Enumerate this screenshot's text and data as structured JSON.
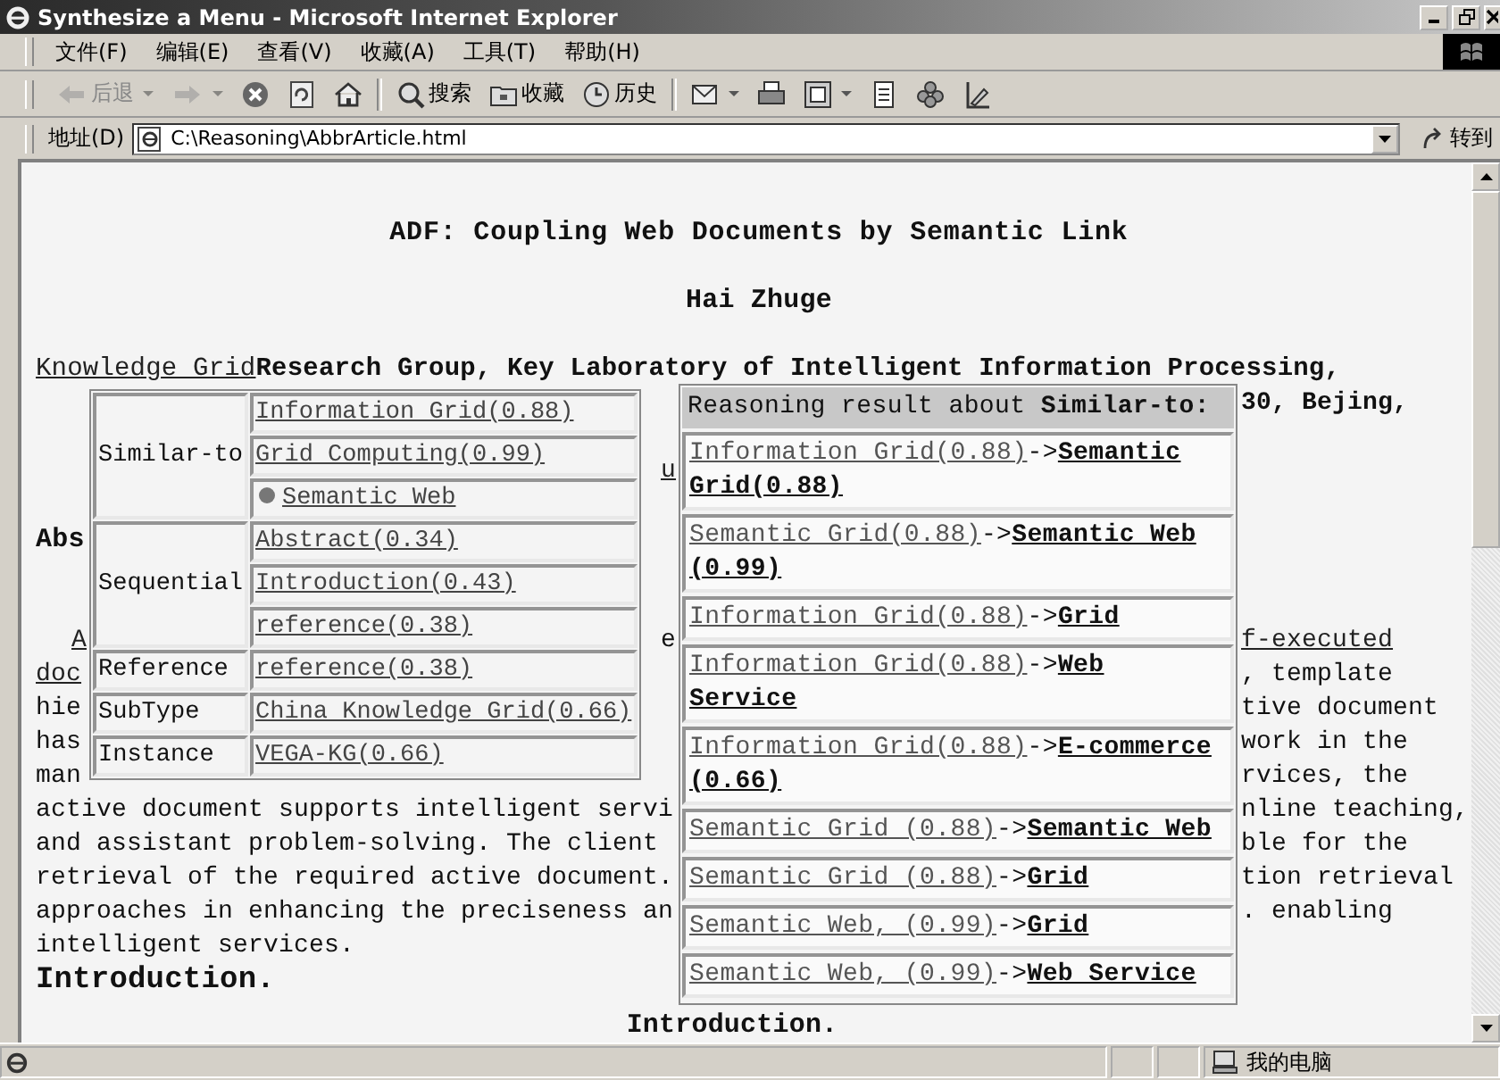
{
  "window": {
    "title": "Synthesize a Menu - Microsoft Internet Explorer"
  },
  "menu": [
    "文件(F)",
    "编辑(E)",
    "查看(V)",
    "收藏(A)",
    "工具(T)",
    "帮助(H)"
  ],
  "toolbar": [
    {
      "kind": "back",
      "label": "后退",
      "disabled": true,
      "dropdown": true
    },
    {
      "kind": "forward",
      "disabled": true,
      "dropdown": true
    },
    {
      "kind": "stop",
      "disabled": false,
      "dropdown": false
    },
    {
      "kind": "refresh",
      "disabled": false,
      "dropdown": false
    },
    {
      "kind": "home",
      "disabled": false,
      "dropdown": false
    },
    {
      "kind": "search",
      "label": "搜索",
      "disabled": false,
      "dropdown": false
    },
    {
      "kind": "favorites",
      "label": "收藏",
      "disabled": false,
      "dropdown": false
    },
    {
      "kind": "history",
      "label": "历史",
      "disabled": false,
      "dropdown": false
    },
    {
      "kind": "mail",
      "disabled": false,
      "dropdown": true
    },
    {
      "kind": "print",
      "disabled": false,
      "dropdown": false
    },
    {
      "kind": "edit",
      "disabled": false,
      "dropdown": true
    },
    {
      "kind": "discuss",
      "disabled": false,
      "dropdown": false
    },
    {
      "kind": "messenger",
      "disabled": false,
      "dropdown": false
    },
    {
      "kind": "research",
      "disabled": false,
      "dropdown": false
    }
  ],
  "address": {
    "label": "地址(D)",
    "value": "C:\\Reasoning\\AbbrArticle.html",
    "go": "转到"
  },
  "article": {
    "title": "ADF: Coupling Web Documents by Semantic Link",
    "author": "Hai Zhuge",
    "affiliation_link": "Knowledge Grid",
    "affiliation": "Research Group, Key Laboratory of Intelligent Information Processing,",
    "rows": [
      {
        "right": {
          "text": "30, Bejing,",
          "kind": "bold"
        }
      },
      {
        "mid": {
          "text": "u",
          "kind": "link"
        }
      },
      {
        "left": {
          "text": "Abs",
          "kind": "heading"
        }
      },
      {
        "left": {
          "text": "A",
          "kind": "indented-link"
        },
        "mid": {
          "text": "e",
          "kind": "plain"
        },
        "right": {
          "text": "f-executed",
          "kind": "link"
        }
      },
      {
        "left": {
          "text": "doc",
          "kind": "link"
        },
        "right": {
          "text": ", template",
          "kind": "plain"
        }
      },
      {
        "left": {
          "text": "hie",
          "kind": "plain"
        },
        "right": {
          "text": "tive document",
          "kind": "plain"
        }
      },
      {
        "left": {
          "text": "has",
          "kind": "plain"
        },
        "right": {
          "text": "work in the",
          "kind": "plain"
        }
      },
      {
        "left": {
          "text": "man",
          "kind": "plain"
        },
        "right": {
          "text": "rvices, the",
          "kind": "plain"
        }
      },
      {
        "left": {
          "text": "active document supports intelligent servi",
          "kind": "plain"
        },
        "right": {
          "text": "nline teaching,",
          "kind": "plain"
        }
      },
      {
        "left": {
          "text": "and assistant problem-solving. The client",
          "kind": "plain"
        },
        "right": {
          "text": "ble for the",
          "kind": "plain"
        }
      },
      {
        "left": {
          "text": "retrieval of the required active document.",
          "kind": "plain"
        },
        "right": {
          "text": "tion retrieval",
          "kind": "plain"
        }
      },
      {
        "left": {
          "text": "approaches in enhancing the preciseness an",
          "kind": "plain"
        },
        "right": {
          "text": ". enabling",
          "kind": "plain"
        }
      },
      {
        "left": {
          "text": "intelligent services.",
          "kind": "plain"
        }
      },
      {
        "left": {
          "text": "Introduction.",
          "kind": "section"
        }
      }
    ],
    "footer_heading": "Introduction."
  },
  "relations_popup": {
    "groups": [
      {
        "relation": "Similar-to",
        "targets": [
          {
            "text": "Information Grid(0.88)",
            "bullet": false
          },
          {
            "text": "Grid Computing(0.99)",
            "bullet": false
          },
          {
            "text": "Semantic Web",
            "bullet": true
          }
        ]
      },
      {
        "relation": "Sequential",
        "targets": [
          {
            "text": "Abstract(0.34)",
            "bullet": false
          },
          {
            "text": "Introduction(0.43)",
            "bullet": false
          },
          {
            "text": "reference(0.38)",
            "bullet": false
          }
        ]
      },
      {
        "relation": "Reference",
        "targets": [
          {
            "text": "reference(0.38)",
            "bullet": false
          }
        ]
      },
      {
        "relation": "SubType",
        "targets": [
          {
            "text": "China Knowledge Grid(0.66)",
            "bullet": false
          }
        ]
      },
      {
        "relation": "Instance",
        "targets": [
          {
            "text": "VEGA-KG(0.66)",
            "bullet": false
          }
        ]
      }
    ]
  },
  "reasoning_popup": {
    "heading": "Reasoning result about ",
    "heading_relation": "Similar-to:",
    "results": [
      {
        "from": "Information Grid(0.88)",
        "arrow": "->",
        "to": "Semantic Grid(0.88)"
      },
      {
        "from": "Semantic Grid(0.88)",
        "arrow": "->",
        "to": "Semantic Web (0.99)"
      },
      {
        "from": "Information Grid(0.88)",
        "arrow": "->",
        "to": "Grid"
      },
      {
        "from": "Information Grid(0.88)",
        "arrow": "->",
        "to": "Web Service"
      },
      {
        "from": "Information Grid(0.88)",
        "arrow": "->",
        "to": "E-commerce (0.66)"
      },
      {
        "from": "Semantic Grid (0.88)",
        "arrow": "->",
        "to": "Semantic Web"
      },
      {
        "from": "Semantic Grid (0.88)",
        "arrow": "->",
        "to": "Grid"
      },
      {
        "from": "Semantic Web, (0.99)",
        "arrow": "->",
        "to": "Grid"
      },
      {
        "from": "Semantic Web, (0.99)",
        "arrow": "->",
        "to": "Web Service"
      }
    ]
  },
  "status_bar": {
    "zone": "我的电脑"
  }
}
